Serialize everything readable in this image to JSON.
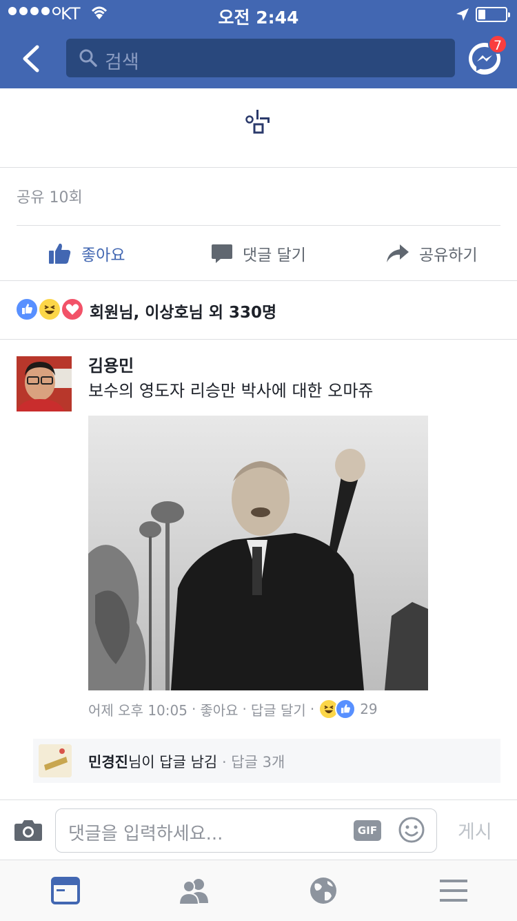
{
  "status_bar": {
    "carrier": "KT",
    "time": "오전 2:44"
  },
  "nav": {
    "search_placeholder": "검색",
    "messenger_badge": "7"
  },
  "post": {
    "share_count": "공유 10회",
    "actions": {
      "like": "좋아요",
      "comment": "댓글 달기",
      "share": "공유하기"
    },
    "reactions_summary": "회원님, 이상호님 외 330명"
  },
  "comment": {
    "author": "김용민",
    "text": "보수의 영도자 리승만 박사에 대한 오마쥬",
    "time": "어제 오후 10:05",
    "like_label": "좋아요",
    "reply_label": "답글 달기",
    "reaction_count": "29",
    "reply_summary": {
      "name": "민경진",
      "suffix": "님이 답글 남김",
      "count": "답글 3개"
    }
  },
  "composer": {
    "placeholder": "댓글을 입력하세요...",
    "gif_label": "GIF",
    "post_label": "게시"
  },
  "colors": {
    "brand": "#4267b2",
    "search_bg": "#29487d",
    "like_blue": "#5890ff",
    "haha": "#fcd648",
    "love": "#f25268",
    "badge": "#fa3e3e"
  }
}
